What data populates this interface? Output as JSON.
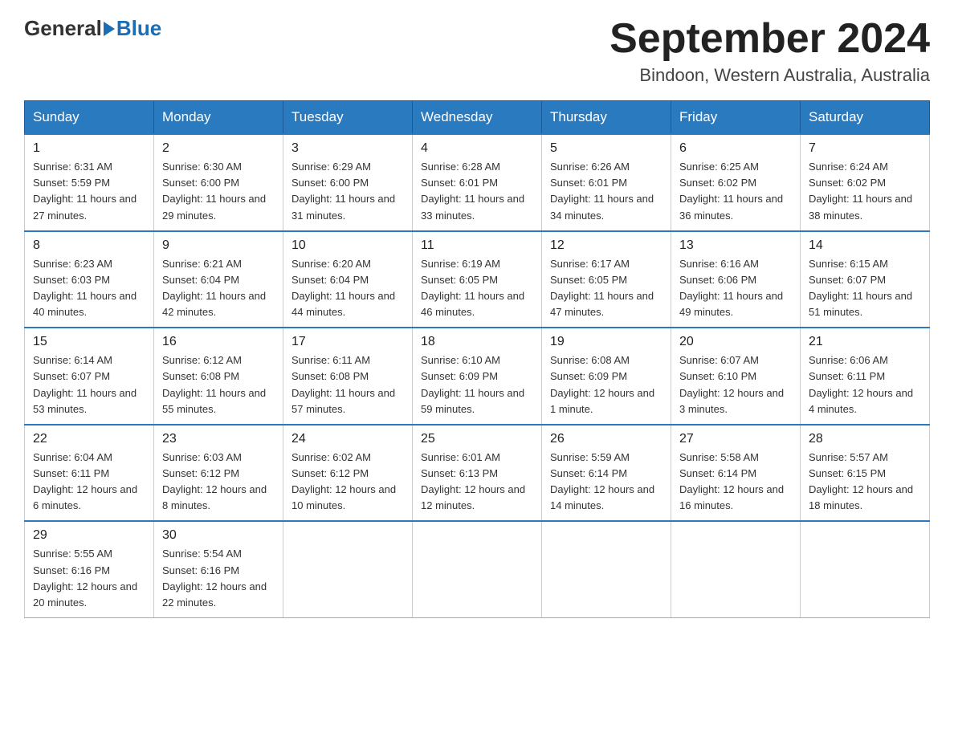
{
  "header": {
    "logo_general": "General",
    "logo_blue": "Blue",
    "month_title": "September 2024",
    "location": "Bindoon, Western Australia, Australia"
  },
  "days_of_week": [
    "Sunday",
    "Monday",
    "Tuesday",
    "Wednesday",
    "Thursday",
    "Friday",
    "Saturday"
  ],
  "weeks": [
    [
      {
        "day": "1",
        "sunrise": "6:31 AM",
        "sunset": "5:59 PM",
        "daylight": "11 hours and 27 minutes."
      },
      {
        "day": "2",
        "sunrise": "6:30 AM",
        "sunset": "6:00 PM",
        "daylight": "11 hours and 29 minutes."
      },
      {
        "day": "3",
        "sunrise": "6:29 AM",
        "sunset": "6:00 PM",
        "daylight": "11 hours and 31 minutes."
      },
      {
        "day": "4",
        "sunrise": "6:28 AM",
        "sunset": "6:01 PM",
        "daylight": "11 hours and 33 minutes."
      },
      {
        "day": "5",
        "sunrise": "6:26 AM",
        "sunset": "6:01 PM",
        "daylight": "11 hours and 34 minutes."
      },
      {
        "day": "6",
        "sunrise": "6:25 AM",
        "sunset": "6:02 PM",
        "daylight": "11 hours and 36 minutes."
      },
      {
        "day": "7",
        "sunrise": "6:24 AM",
        "sunset": "6:02 PM",
        "daylight": "11 hours and 38 minutes."
      }
    ],
    [
      {
        "day": "8",
        "sunrise": "6:23 AM",
        "sunset": "6:03 PM",
        "daylight": "11 hours and 40 minutes."
      },
      {
        "day": "9",
        "sunrise": "6:21 AM",
        "sunset": "6:04 PM",
        "daylight": "11 hours and 42 minutes."
      },
      {
        "day": "10",
        "sunrise": "6:20 AM",
        "sunset": "6:04 PM",
        "daylight": "11 hours and 44 minutes."
      },
      {
        "day": "11",
        "sunrise": "6:19 AM",
        "sunset": "6:05 PM",
        "daylight": "11 hours and 46 minutes."
      },
      {
        "day": "12",
        "sunrise": "6:17 AM",
        "sunset": "6:05 PM",
        "daylight": "11 hours and 47 minutes."
      },
      {
        "day": "13",
        "sunrise": "6:16 AM",
        "sunset": "6:06 PM",
        "daylight": "11 hours and 49 minutes."
      },
      {
        "day": "14",
        "sunrise": "6:15 AM",
        "sunset": "6:07 PM",
        "daylight": "11 hours and 51 minutes."
      }
    ],
    [
      {
        "day": "15",
        "sunrise": "6:14 AM",
        "sunset": "6:07 PM",
        "daylight": "11 hours and 53 minutes."
      },
      {
        "day": "16",
        "sunrise": "6:12 AM",
        "sunset": "6:08 PM",
        "daylight": "11 hours and 55 minutes."
      },
      {
        "day": "17",
        "sunrise": "6:11 AM",
        "sunset": "6:08 PM",
        "daylight": "11 hours and 57 minutes."
      },
      {
        "day": "18",
        "sunrise": "6:10 AM",
        "sunset": "6:09 PM",
        "daylight": "11 hours and 59 minutes."
      },
      {
        "day": "19",
        "sunrise": "6:08 AM",
        "sunset": "6:09 PM",
        "daylight": "12 hours and 1 minute."
      },
      {
        "day": "20",
        "sunrise": "6:07 AM",
        "sunset": "6:10 PM",
        "daylight": "12 hours and 3 minutes."
      },
      {
        "day": "21",
        "sunrise": "6:06 AM",
        "sunset": "6:11 PM",
        "daylight": "12 hours and 4 minutes."
      }
    ],
    [
      {
        "day": "22",
        "sunrise": "6:04 AM",
        "sunset": "6:11 PM",
        "daylight": "12 hours and 6 minutes."
      },
      {
        "day": "23",
        "sunrise": "6:03 AM",
        "sunset": "6:12 PM",
        "daylight": "12 hours and 8 minutes."
      },
      {
        "day": "24",
        "sunrise": "6:02 AM",
        "sunset": "6:12 PM",
        "daylight": "12 hours and 10 minutes."
      },
      {
        "day": "25",
        "sunrise": "6:01 AM",
        "sunset": "6:13 PM",
        "daylight": "12 hours and 12 minutes."
      },
      {
        "day": "26",
        "sunrise": "5:59 AM",
        "sunset": "6:14 PM",
        "daylight": "12 hours and 14 minutes."
      },
      {
        "day": "27",
        "sunrise": "5:58 AM",
        "sunset": "6:14 PM",
        "daylight": "12 hours and 16 minutes."
      },
      {
        "day": "28",
        "sunrise": "5:57 AM",
        "sunset": "6:15 PM",
        "daylight": "12 hours and 18 minutes."
      }
    ],
    [
      {
        "day": "29",
        "sunrise": "5:55 AM",
        "sunset": "6:16 PM",
        "daylight": "12 hours and 20 minutes."
      },
      {
        "day": "30",
        "sunrise": "5:54 AM",
        "sunset": "6:16 PM",
        "daylight": "12 hours and 22 minutes."
      },
      null,
      null,
      null,
      null,
      null
    ]
  ],
  "labels": {
    "sunrise": "Sunrise:",
    "sunset": "Sunset:",
    "daylight": "Daylight:"
  }
}
